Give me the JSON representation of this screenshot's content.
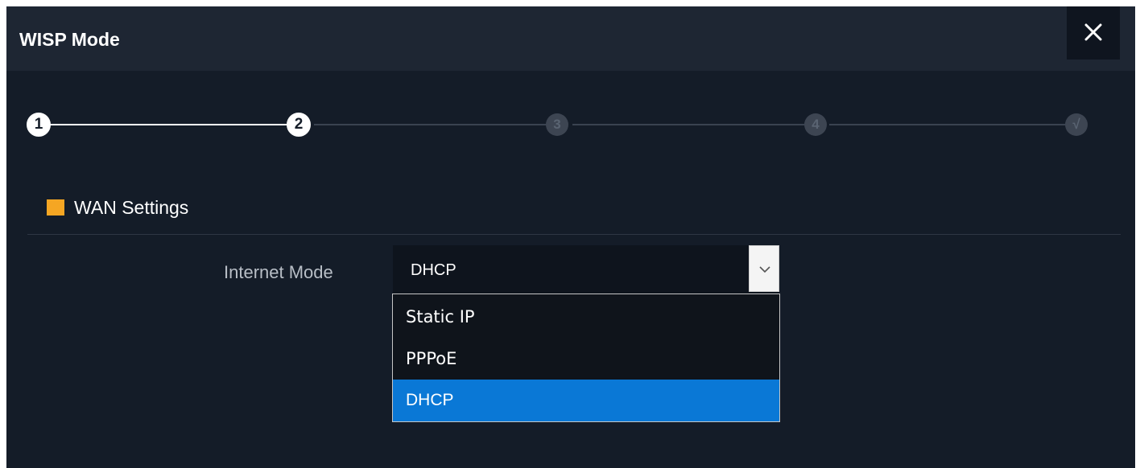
{
  "dialog": {
    "title": "WISP Mode",
    "close_label": "✕"
  },
  "stepper": {
    "steps": [
      "1",
      "2",
      "3",
      "4",
      "√"
    ],
    "current_step": 2
  },
  "section": {
    "title": "WAN Settings",
    "marker_color": "#f5a623"
  },
  "internet_mode": {
    "label": "Internet Mode",
    "value": "DHCP",
    "options": [
      "Static IP",
      "PPPoE",
      "DHCP"
    ],
    "highlight_color": "#0a78d6"
  }
}
